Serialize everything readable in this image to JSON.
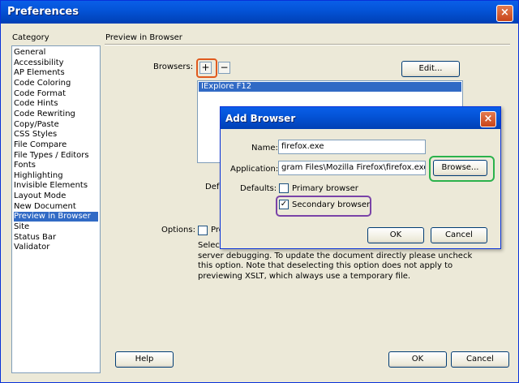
{
  "window": {
    "title": "Preferences",
    "close_glyph": "×"
  },
  "category": {
    "heading": "Category",
    "items": [
      "General",
      "Accessibility",
      "AP Elements",
      "Code Coloring",
      "Code Format",
      "Code Hints",
      "Code Rewriting",
      "Copy/Paste",
      "CSS Styles",
      "File Compare",
      "File Types / Editors",
      "Fonts",
      "Highlighting",
      "Invisible Elements",
      "Layout Mode",
      "New Document",
      "Preview in Browser",
      "Site",
      "Status Bar",
      "Validator"
    ],
    "selected_index": 16
  },
  "panel": {
    "title": "Preview in Browser",
    "browsers_label": "Browsers:",
    "add_glyph": "+",
    "remove_glyph": "−",
    "edit_label": "Edit...",
    "browser_list": [
      "IExplore    F12"
    ],
    "defaults_label": "Def",
    "options_label": "Options:",
    "option_partial": "Pre",
    "desc_line1": "Select",
    "desc_line2": "server debugging. To update the document directly please uncheck",
    "desc_line3": "this option. Note that deselecting this option does not apply to",
    "desc_line4": "previewing XSLT, which always use a temporary file."
  },
  "dialog": {
    "title": "Add Browser",
    "close_glyph": "×",
    "name_label": "Name:",
    "name_value": "firefox.exe",
    "application_label": "Application:",
    "application_value": "gram Files\\Mozilla Firefox\\firefox.exe",
    "browse_label": "Browse...",
    "defaults_label": "Defaults:",
    "primary_label": "Primary browser",
    "primary_checked": false,
    "secondary_label": "Secondary browser",
    "secondary_checked": true,
    "check_glyph": "✓",
    "ok_label": "OK",
    "cancel_label": "Cancel"
  },
  "footer": {
    "help_label": "Help",
    "ok_label": "OK",
    "cancel_label": "Cancel"
  },
  "colors": {
    "selection": "#316ac5",
    "title_blue": "#0454d8",
    "highlight_red": "#e05a1e",
    "highlight_green": "#2bb24c",
    "highlight_purple": "#7a43a8"
  }
}
